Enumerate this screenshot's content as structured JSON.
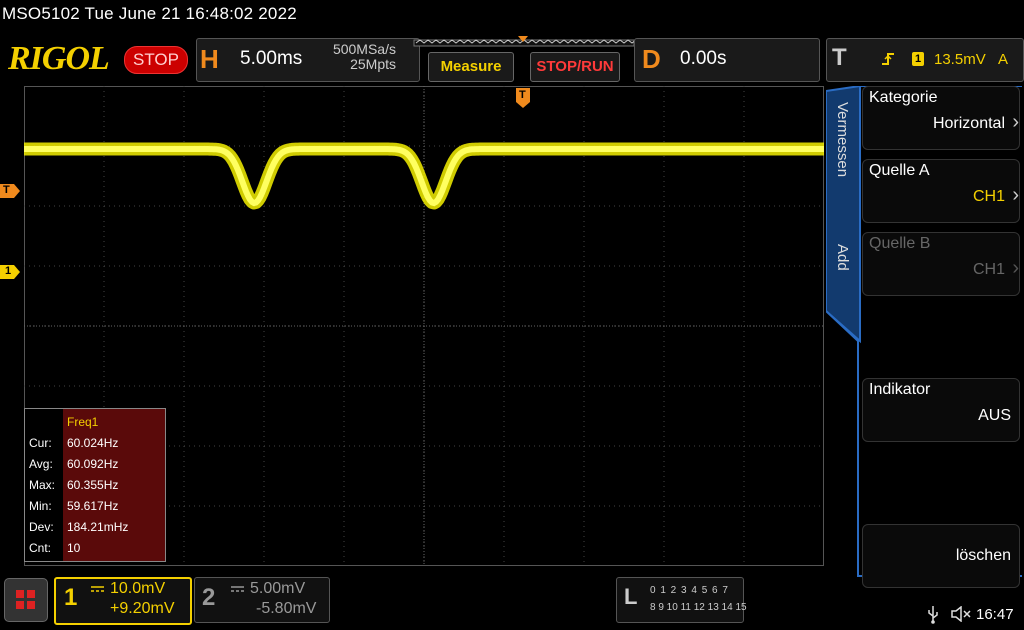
{
  "header": {
    "model_datetime": "MSO5102  Tue June 21 16:48:02 2022",
    "logo": "RIGOL",
    "status": "STOP",
    "horizontal": {
      "letter": "H",
      "scale": "5.00ms",
      "sample_rate": "500MSa/s",
      "memory": "25Mpts"
    },
    "measure_button": "Measure",
    "stoprun_button": "STOP/RUN",
    "delay": {
      "letter": "D",
      "value": "0.00s"
    },
    "trigger": {
      "letter": "T",
      "source_marker": "1",
      "level": "13.5mV",
      "mode": "A"
    }
  },
  "markers": {
    "trigger_level": "T",
    "channel1": "1",
    "trigger_pos": "T"
  },
  "waveform": {
    "color": "#f4f000",
    "baseline_y_div": 1.05,
    "dip_depth_div": 0.9,
    "dip_centers_ms": [
      -10.6,
      0.6
    ],
    "x_range_ms": [
      -25,
      25
    ]
  },
  "measurement": {
    "title": "Freq1",
    "rows": [
      {
        "label": "Cur:",
        "value": "60.024Hz"
      },
      {
        "label": "Avg:",
        "value": "60.092Hz"
      },
      {
        "label": "Max:",
        "value": "60.355Hz"
      },
      {
        "label": "Min:",
        "value": "59.617Hz"
      },
      {
        "label": "Dev:",
        "value": "184.21mHz"
      },
      {
        "label": "Cnt:",
        "value": "10"
      }
    ]
  },
  "side_tabs": {
    "tab1": "Vermessen",
    "tab2": "Add"
  },
  "side_menu": [
    {
      "label": "Kategorie",
      "value": "Horizontal",
      "enabled": true
    },
    {
      "label": "Quelle A",
      "value": "CH1",
      "enabled": true,
      "value_color": "#f4d000"
    },
    {
      "label": "Quelle B",
      "value": "CH1",
      "enabled": false
    },
    {
      "label": "Indikator",
      "value": "AUS",
      "enabled": true
    },
    {
      "label": "",
      "value": "löschen",
      "enabled": true
    }
  ],
  "channels": {
    "ch1": {
      "num": "1",
      "scale": "10.0mV",
      "offset": "+9.20mV"
    },
    "ch2": {
      "num": "2",
      "scale": "5.00mV",
      "offset": "-5.80mV"
    }
  },
  "logic": {
    "letter": "L",
    "row1": "0 1 2 3  4 5 6 7",
    "row2": "8 9 10 11 12 13 14 15"
  },
  "clock": "16:47",
  "colors": {
    "ch1": "#f4d000",
    "accent_orange": "#f08a1d",
    "panel_blue": "#1f5fb0",
    "stop_red": "#cc0000"
  }
}
